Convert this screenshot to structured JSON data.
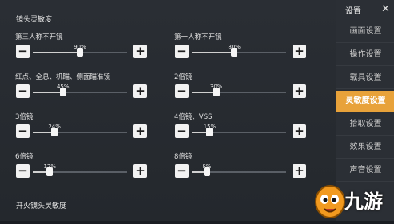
{
  "top_section_title": "镜头灵敏度",
  "bottom_section_title": "开火镜头灵敏度",
  "sliders": [
    {
      "label": "第三人称不开镜",
      "percent": "90%",
      "value": 0.5
    },
    {
      "label": "第一人称不开镜",
      "percent": "80%",
      "value": 0.45
    },
    {
      "label": "红点、全息、机瞄、侧面瞄准镜",
      "percent": "45%",
      "value": 0.32
    },
    {
      "label": "2倍镜",
      "percent": "30%",
      "value": 0.26
    },
    {
      "label": "3倍镜",
      "percent": "24%",
      "value": 0.23
    },
    {
      "label": "4倍镜、VSS",
      "percent": "15%",
      "value": 0.19
    },
    {
      "label": "6倍镜",
      "percent": "12%",
      "value": 0.18
    },
    {
      "label": "8倍镜",
      "percent": "8%",
      "value": 0.16
    }
  ],
  "sidebar": {
    "title": "设置",
    "close": "✕",
    "items": [
      {
        "label": "画面设置"
      },
      {
        "label": "操作设置"
      },
      {
        "label": "载具设置"
      },
      {
        "label": "灵敏度设置",
        "active": true
      },
      {
        "label": "拾取设置"
      },
      {
        "label": "效果设置"
      },
      {
        "label": "声音设置"
      }
    ]
  },
  "icons": {
    "minus": "minus-icon",
    "plus": "plus-icon",
    "close": "close-icon"
  },
  "watermark": {
    "text": "九游"
  },
  "colors": {
    "accent": "#e8a23a",
    "panel": "#2a2e34"
  }
}
